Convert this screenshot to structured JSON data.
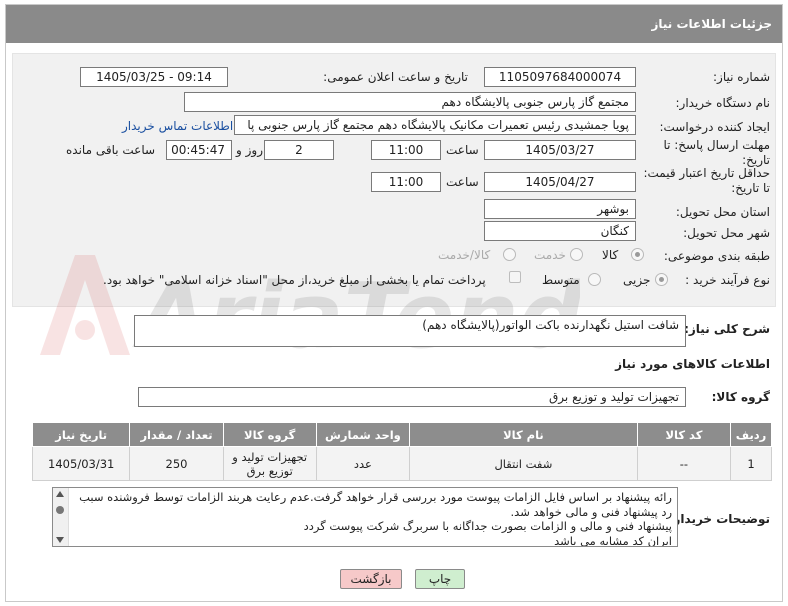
{
  "header": {
    "title": "جزئیات اطلاعات نیاز"
  },
  "fields": {
    "need_number_label": "شماره نیاز:",
    "need_number": "1105097684000074",
    "announce_label": "تاریخ و ساعت اعلان عمومی:",
    "announce_value": "1405/03/25 - 09:14",
    "buyer_org_label": "نام دستگاه خریدار:",
    "buyer_org": "مجتمع گاز پارس جنوبی  پالایشگاه دهم",
    "requester_label": "ایجاد کننده درخواست:",
    "requester": "پویا جمشیدی رئیس تعمیرات مکانیک پالایشگاه دهم  مجتمع گاز پارس جنوبی  پا",
    "contact_link": "اطلاعات تماس خریدار",
    "reply_deadline_label": "مهلت ارسال پاسخ: تا تاریخ:",
    "reply_date": "1405/03/27",
    "time_label": "ساعت",
    "reply_time": "11:00",
    "days_value": "2",
    "days_label": "روز و",
    "remaining_time": "00:45:47",
    "remaining_label": "ساعت باقی مانده",
    "price_deadline_label": "حداقل تاریخ اعتبار قیمت: تا تاریخ:",
    "price_date": "1405/04/27",
    "price_time": "11:00",
    "province_label": "استان محل تحویل:",
    "province": "بوشهر",
    "city_label": "شهر محل تحویل:",
    "city": "کنگان",
    "category_label": "طبقه بندی موضوعی:",
    "category_options": [
      "کالا",
      "خدمت",
      "کالا/خدمت"
    ],
    "process_label": "نوع فرآیند خرید :",
    "process_options": [
      "جزیی",
      "متوسط"
    ],
    "payment_note": "پرداخت تمام یا بخشی از مبلغ خرید،از محل \"اسناد خزانه اسلامی\" خواهد بود."
  },
  "need_desc": {
    "label": "شرح کلی نیاز:",
    "value": "شافت استیل نگهدارنده باکت الواتور(پالایشگاه دهم)"
  },
  "goods_info": {
    "title": "اطلاعات کالاهای مورد نیاز",
    "group_label": "گروه کالا:",
    "group_value": "تجهیزات تولید و توزیع برق"
  },
  "table": {
    "headers": [
      "ردیف",
      "کد کالا",
      "نام کالا",
      "واحد شمارش",
      "گروه کالا",
      "تعداد / مقدار",
      "تاریخ نیاز"
    ],
    "rows": [
      [
        "1",
        "--",
        "شفت انتقال",
        "عدد",
        "تجهیزات تولید و توزیع برق",
        "250",
        "1405/03/31"
      ]
    ]
  },
  "buyer_notes": {
    "label": "توضیحات خریدار:",
    "lines": [
      "رائه پیشنهاد بر اساس فایل الزامات پیوست مورد بررسی قرار خواهد گرفت.عدم رعایت هربند الزامات توسط فروشنده سبب",
      "رد پیشنهاد فنی و مالی خواهد شد.",
      "پیشنهاد فنی و مالی و الزامات بصورت جداگانه با سربرگ شرکت پیوست گردد",
      "ایران کد مشابه می باشد"
    ]
  },
  "buttons": {
    "print": "چاپ",
    "back": "بازگشت"
  },
  "watermark": "AriaTender.net",
  "colors": {
    "header_bg": "#8a8a8a",
    "print_btn": "#cfeecf",
    "back_btn": "#f6c9c9",
    "link": "#1a4fa0"
  }
}
